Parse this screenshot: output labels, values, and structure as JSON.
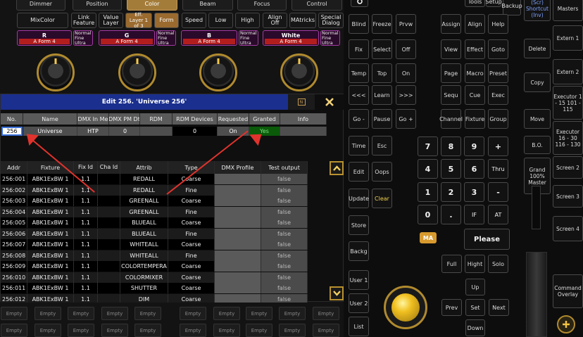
{
  "top_tabs": [
    "Dimmer",
    "Position",
    "Color",
    "Beam",
    "Focus",
    "Control"
  ],
  "func_buttons": [
    {
      "label": "MixColor",
      "on": false
    },
    {
      "label": "Link Feature",
      "on": false
    },
    {
      "label": "Value Layer",
      "on": false
    },
    {
      "label": "Eff. Layer 1 of 3",
      "on": true
    },
    {
      "label": "Form",
      "on": true
    },
    {
      "label": "Speed",
      "on": false
    },
    {
      "label": "Low",
      "on": false
    },
    {
      "label": "High",
      "on": false
    },
    {
      "label": "Align Off",
      "on": false
    },
    {
      "label": "MAtricks",
      "on": false
    },
    {
      "label": "Special Dialog",
      "on": false
    }
  ],
  "attr_bars": [
    {
      "name": "R",
      "value": "A Form 4",
      "mode": "Normal Fine Ultra"
    },
    {
      "name": "G",
      "value": "A Form 4",
      "mode": "Normal Fine Ultra"
    },
    {
      "name": "B",
      "value": "A Form 4",
      "mode": "Normal Fine Ultra"
    },
    {
      "name": "White",
      "value": "A Form 4",
      "mode": "Normal Fine Ultra"
    }
  ],
  "dialog": {
    "title": "Edit 256. 'Universe 256'",
    "info_icon": "info-icon",
    "close_icon": "close-icon",
    "top_headers": [
      "No.",
      "Name",
      "DMX In Me",
      "DMX PM Dt",
      "RDM",
      "RDM Devices",
      "Requested",
      "Granted",
      "Info"
    ],
    "top_values": [
      "256",
      "Universe",
      "HTP",
      "0",
      "",
      "0",
      "On",
      "Yes",
      ""
    ],
    "table_headers": [
      "Addr",
      "Fixture",
      "Fix Id",
      "Cha Id",
      "Attrib",
      "Type",
      "DMX Profile",
      "Test output"
    ],
    "rows": [
      [
        "256:001",
        "ABK1ExBW 1",
        "1.1",
        "",
        "REDALL",
        "Coarse",
        "",
        "false"
      ],
      [
        "256:002",
        "ABK1ExBW 1",
        "1.1",
        "",
        "REDALL",
        "Fine",
        "",
        "false"
      ],
      [
        "256:003",
        "ABK1ExBW 1",
        "1.1",
        "",
        "GREENALL",
        "Coarse",
        "",
        "false"
      ],
      [
        "256:004",
        "ABK1ExBW 1",
        "1.1",
        "",
        "GREENALL",
        "Fine",
        "",
        "false"
      ],
      [
        "256:005",
        "ABK1ExBW 1",
        "1.1",
        "",
        "BLUEALL",
        "Coarse",
        "",
        "false"
      ],
      [
        "256:006",
        "ABK1ExBW 1",
        "1.1",
        "",
        "BLUEALL",
        "Fine",
        "",
        "false"
      ],
      [
        "256:007",
        "ABK1ExBW 1",
        "1.1",
        "",
        "WHITEALL",
        "Coarse",
        "",
        "false"
      ],
      [
        "256:008",
        "ABK1ExBW 1",
        "1.1",
        "",
        "WHITEALL",
        "Fine",
        "",
        "false"
      ],
      [
        "256:009",
        "ABK1ExBW 1",
        "1.1",
        "",
        "COLORTEMPERA",
        "Coarse",
        "",
        "false"
      ],
      [
        "256:010",
        "ABK1ExBW 1",
        "1.1",
        "",
        "COLORMIXER",
        "Coarse",
        "",
        "false"
      ],
      [
        "256:011",
        "ABK1ExBW 1",
        "1.1",
        "",
        "SHUTTER",
        "Coarse",
        "",
        "false"
      ],
      [
        "256:012",
        "ABK1ExBW 1",
        "1.1",
        "",
        "DIM",
        "Coarse",
        "",
        "false"
      ]
    ]
  },
  "empty_label": "Empty",
  "console": {
    "col1": [
      "Blind",
      "Fix",
      "Temp",
      "<<<",
      "Go -",
      "Time",
      "Edit",
      "Update",
      "Store",
      "Backg",
      "User 1",
      "User 2",
      "List"
    ],
    "col2": [
      "Freeze",
      "Select",
      "Top",
      "Learn",
      "Pause",
      "Esc",
      "Oops",
      "Clear"
    ],
    "col3": [
      "Prvw",
      "Off",
      "On",
      ">>>",
      "Go +"
    ],
    "col4": [
      "Assign",
      "View",
      "Page",
      "Sequ",
      "Channel"
    ],
    "col5": [
      "Tools",
      "Align",
      "Effect",
      "Macro",
      "Cue",
      "Fixture"
    ],
    "col6": [
      "Setup",
      "Backup",
      "Help",
      "Goto",
      "Preset",
      "Exec",
      "Group"
    ],
    "keypad": [
      "7",
      "8",
      "9",
      "+",
      "4",
      "5",
      "6",
      "Thru",
      "1",
      "2",
      "3",
      "-",
      "0",
      ".",
      "IF",
      "AT"
    ],
    "ma_label": "MA",
    "please": "Please",
    "full_row": [
      "Full",
      "Hight",
      "Solo"
    ],
    "nav": [
      "Up",
      "Prev",
      "Set",
      "Next",
      "Down"
    ],
    "right_col": [
      "(Scr) Shortcut (Inv)",
      "Masters",
      "Extern 1",
      "Delete",
      "Extern 2",
      "Copy",
      "Executor 1 - 15 101 - 115",
      "Move",
      "Executor 16 - 30 116 - 130",
      "B.O.",
      "Screen 2",
      "Grand 100% Master",
      "Screen 3",
      "Screen 4",
      "Command Overlay"
    ]
  }
}
